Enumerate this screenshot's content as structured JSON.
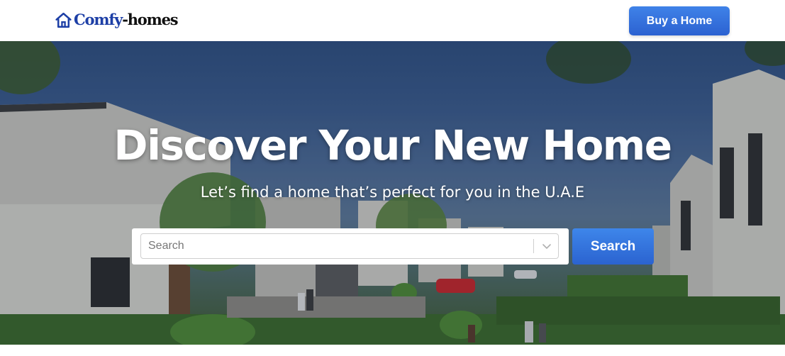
{
  "header": {
    "logo_part1": "Comfy",
    "logo_part2": "-homes",
    "logo_icon": "house-icon",
    "buy_button_label": "Buy a Home"
  },
  "hero": {
    "title": "Discover Your New Home",
    "subtitle": "Let’s find a home that’s perfect for you in the U.A.E",
    "search": {
      "placeholder": "Search",
      "value": "",
      "dropdown_icon": "chevron-down-icon",
      "button_label": "Search"
    }
  },
  "colors": {
    "brand_blue": "#1d3fa6",
    "button_blue": "#2f6ddc"
  }
}
